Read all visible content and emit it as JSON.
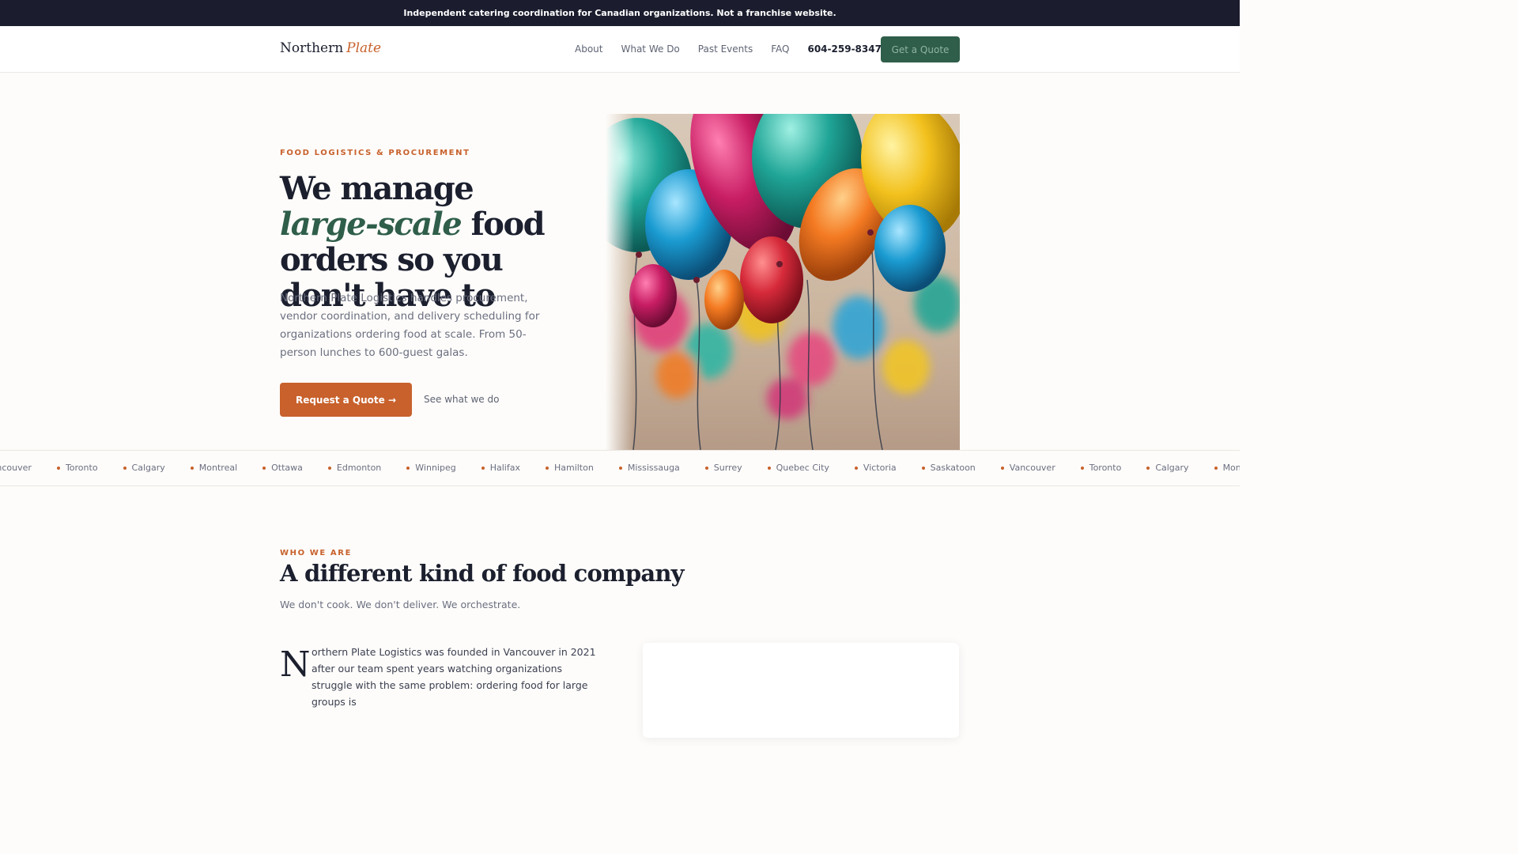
{
  "banner": {
    "text": "Independent catering coordination for Canadian organizations. Not a franchise website."
  },
  "nav": {
    "brand_primary": "Northern",
    "brand_accent": "Plate",
    "links": [
      "About",
      "What We Do",
      "Past Events",
      "FAQ"
    ],
    "phone": "604-259-8347",
    "cta_label": "Get a Quote"
  },
  "hero": {
    "eyebrow": "FOOD LOGISTICS & PROCUREMENT",
    "title_part1": "We manage ",
    "title_emphasis": "large-scale",
    "title_part2": " food orders so you don't have to",
    "description": "Northern Plate Logistics handles procurement, vendor coordination, and delivery scheduling for organizations ordering food at scale. From 50-person lunches to 600-guest galas.",
    "primary_cta": "Request a Quote →",
    "secondary_cta": "See what we do",
    "image_subject": "colorful-balloons-photo"
  },
  "cities": [
    "Vancouver",
    "Toronto",
    "Calgary",
    "Montreal",
    "Ottawa",
    "Edmonton",
    "Winnipeg",
    "Halifax",
    "Hamilton",
    "Mississauga",
    "Surrey",
    "Quebec City",
    "Victoria",
    "Saskatoon",
    "Vancouver",
    "Toronto",
    "Calgary",
    "Montreal"
  ],
  "about": {
    "eyebrow": "WHO WE ARE",
    "title": "A different kind of food company",
    "subtitle": "We don't cook. We don't deliver. We orchestrate.",
    "dropcap": "N",
    "body": "orthern Plate Logistics was founded in Vancouver in 2021 after our team spent years watching organizations struggle with the same problem: ordering food for large groups is"
  },
  "colors": {
    "accent": "#c8612c",
    "brand_green": "#2f5e4a",
    "topbar": "#1b1d2e",
    "text": "#1b1f2e"
  }
}
